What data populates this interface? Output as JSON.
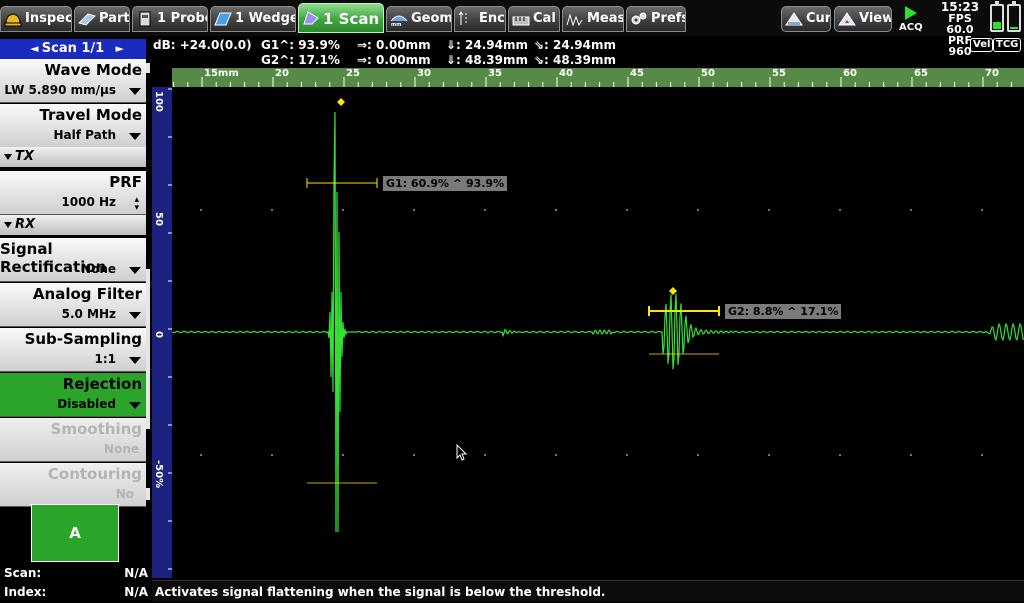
{
  "toolbar": {
    "tabs": [
      {
        "label": "Inspec",
        "icon": "inspection-hardhat-icon"
      },
      {
        "label": "Part",
        "icon": "part-icon"
      },
      {
        "label": "1 Probe",
        "icon": "probe-icon"
      },
      {
        "label": "1 Wedge",
        "icon": "wedge-icon"
      },
      {
        "label": "1 Scan",
        "icon": "scan-icon"
      },
      {
        "label": "Geom",
        "icon": "geometry-icon"
      },
      {
        "label": "Enc",
        "icon": "encoder-icon"
      },
      {
        "label": "Cal",
        "icon": "calibration-icon"
      },
      {
        "label": "Meas",
        "icon": "measurement-icon"
      },
      {
        "label": "Prefs",
        "icon": "gears-icon"
      }
    ],
    "right_tabs": [
      {
        "label": "Cur",
        "icon": "cursor-icon"
      },
      {
        "label": "View",
        "icon": "view-icon"
      }
    ],
    "acq_label": "ACQ",
    "time": "15:23",
    "fps": "FPS 60.0",
    "prf": "PRF 960",
    "battery_levels": [
      0.3,
      0.05
    ],
    "battery_color": "#2ee02e",
    "active_tab_color": "#3ea63e"
  },
  "left_panel": {
    "scan_header": "Scan 1/1",
    "params": [
      {
        "title": "Wave Mode",
        "value": "LW 5.890 mm/µs"
      },
      {
        "title": "Travel Mode",
        "value": "Half Path"
      },
      {
        "title": "PRF",
        "value": "1000 Hz"
      },
      {
        "title": "Signal Rectification",
        "value": "None"
      },
      {
        "title": "Analog Filter",
        "value": "5.0 MHz"
      },
      {
        "title": "Sub-Sampling",
        "value": "1:1"
      },
      {
        "title": "Rejection",
        "value": "Disabled"
      },
      {
        "title": "Smoothing",
        "value": "None"
      },
      {
        "title": "Contouring",
        "value": "No"
      }
    ],
    "sections": [
      "TX",
      "RX"
    ],
    "button_a": "A",
    "scan_label": "Scan:",
    "scan_value": "N/A",
    "index_label": "Index:",
    "index_value": "N/A"
  },
  "readout": {
    "db": "dB: +24.0(0.0)",
    "g1_amp": "G1^: 93.9%",
    "g1_r1": "⇒: 0.00mm",
    "g1_r2": "⇓: 24.94mm",
    "g1_r3": "⇘: 24.94mm",
    "g2_amp": "G2^: 17.1%",
    "g2_r1": "⇒: 0.00mm",
    "g2_r2": "⇓: 48.39mm",
    "g2_r3": "⇘: 48.39mm",
    "vel_badge": "Vel",
    "tcg_badge": "TCG"
  },
  "ruler_top": {
    "first_label_suffix": "mm",
    "ticks": [
      15,
      20,
      25,
      30,
      35,
      40,
      45,
      50,
      55,
      60,
      65,
      70
    ]
  },
  "ruler_left": {
    "ticks": [
      "100",
      "50",
      "0",
      "-50%"
    ]
  },
  "gates": [
    {
      "label": "G1: 60.9% ^ 93.9%",
      "color": "#ffe600"
    },
    {
      "label": "G2: 8.8% ^ 17.1%",
      "color": "#ffe600"
    }
  ],
  "signal_color": "#34e034",
  "status_text": "Activates signal flattening when the signal is below the threshold."
}
